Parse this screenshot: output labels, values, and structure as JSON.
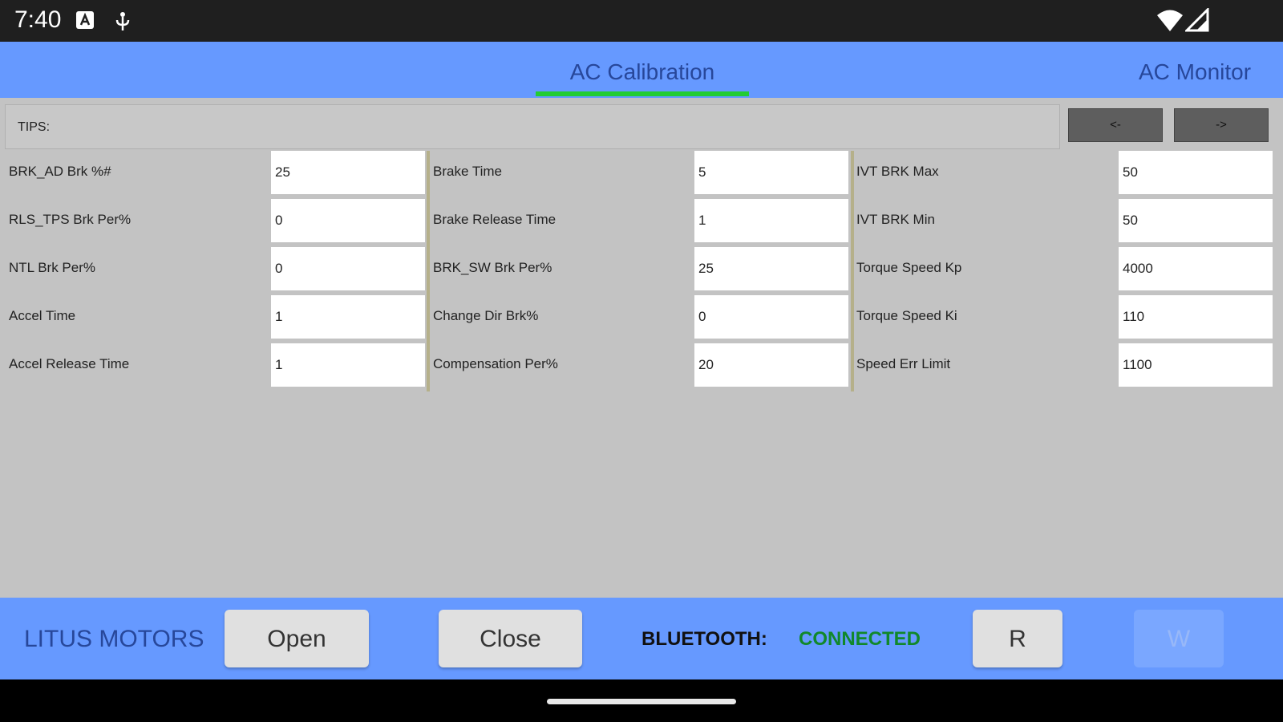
{
  "status_bar": {
    "time": "7:40",
    "icons": [
      "notification-a-icon",
      "usb-debug-icon",
      "wifi-icon",
      "cell-signal-icon"
    ]
  },
  "tabs": [
    {
      "label": "AC Calibration",
      "active": true
    },
    {
      "label": "AC Monitor",
      "active": false
    }
  ],
  "tips": {
    "label": "TIPS:"
  },
  "nav_buttons": {
    "prev": "<-",
    "next": "->"
  },
  "fields": {
    "col1": [
      {
        "label": "BRK_AD Brk %#",
        "value": "25"
      },
      {
        "label": "RLS_TPS Brk Per%",
        "value": "0"
      },
      {
        "label": "NTL Brk Per%",
        "value": "0"
      },
      {
        "label": "Accel Time",
        "value": "1"
      },
      {
        "label": "Accel Release Time",
        "value": "1"
      }
    ],
    "col2": [
      {
        "label": "Brake Time",
        "value": "5"
      },
      {
        "label": "Brake Release Time",
        "value": "1"
      },
      {
        "label": "BRK_SW Brk Per%",
        "value": "25"
      },
      {
        "label": "Change Dir Brk%",
        "value": "0"
      },
      {
        "label": "Compensation Per%",
        "value": "20"
      }
    ],
    "col3": [
      {
        "label": "IVT BRK Max",
        "value": "50"
      },
      {
        "label": "IVT BRK Min",
        "value": "50"
      },
      {
        "label": "Torque Speed Kp",
        "value": "4000"
      },
      {
        "label": "Torque Speed Ki",
        "value": "110"
      },
      {
        "label": "Speed Err Limit",
        "value": "1100"
      }
    ]
  },
  "bottom": {
    "brand": "LITUS MOTORS",
    "open": "Open",
    "close": "Close",
    "bluetooth_label": "BLUETOOTH:",
    "bluetooth_status": "CONNECTED",
    "read": "R",
    "write": "W"
  },
  "colors": {
    "bar_blue": "#6699ff",
    "tab_indicator": "#22cc33",
    "connected_green": "#11882a",
    "background_gray": "#c3c3c3"
  }
}
